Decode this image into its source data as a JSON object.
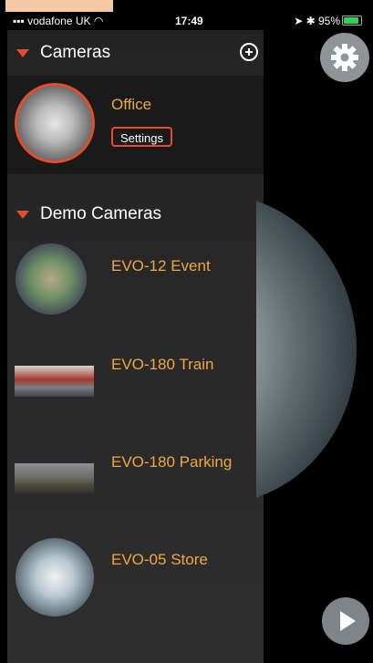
{
  "status_bar": {
    "carrier": "vodafone UK",
    "time": "17:49",
    "battery": "95%"
  },
  "cameras_section": {
    "title": "Cameras",
    "items": [
      {
        "name": "Office",
        "settings_label": "Settings"
      }
    ]
  },
  "demo_section": {
    "title": "Demo Cameras",
    "items": [
      {
        "name": "EVO-12 Event"
      },
      {
        "name": "EVO-180 Train"
      },
      {
        "name": "EVO-180 Parking"
      },
      {
        "name": "EVO-05 Store"
      }
    ]
  },
  "colors": {
    "accent": "#e64b2a",
    "camera_name": "#f0a742",
    "panel": "#2a2a2a"
  },
  "icons": {
    "add": "plus-circle-icon",
    "settings": "gear-icon",
    "play": "play-icon"
  }
}
